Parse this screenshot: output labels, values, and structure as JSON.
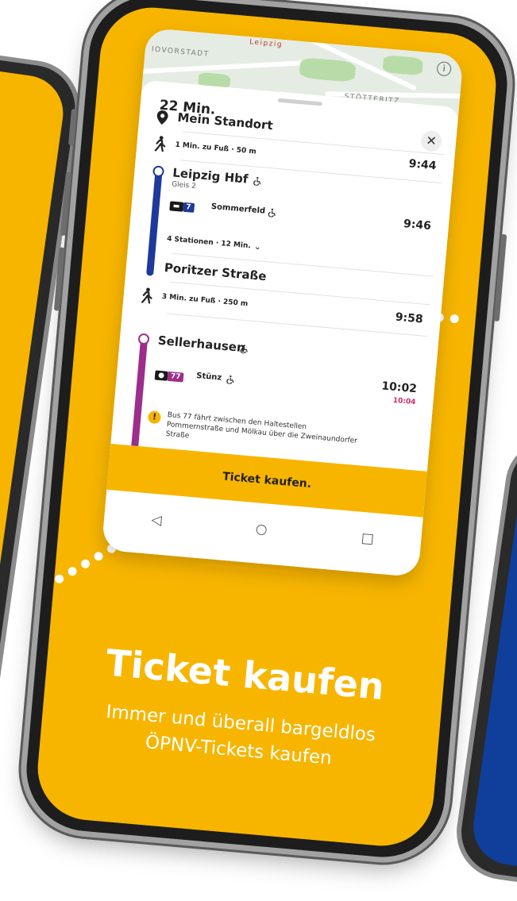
{
  "map": {
    "label_left": "IOVORSTADT",
    "label_top": "Leipzig",
    "label_right": "STÖTTERITZ",
    "info_glyph": "i"
  },
  "trip": {
    "duration": "22 Min.",
    "close_glyph": "✕",
    "start": {
      "name": "Mein Standort"
    },
    "walk1": {
      "text": "1 Min. zu Fuß · 50 m",
      "time": "9:44"
    },
    "stop1": {
      "name": "Leipzig Hbf",
      "platform": "Gleis 2",
      "line_badge": "7",
      "direction": "Sommerfeld",
      "time": "9:46",
      "stations": "4 Stationen · 12 Min."
    },
    "stop2": {
      "name": "Poritzer Straße"
    },
    "walk2": {
      "text": "3 Min. zu Fuß · 250 m",
      "time": "9:58"
    },
    "stop3": {
      "name": "Sellerhausen",
      "line_badge": "77",
      "direction": "Stünz",
      "time": "10:02",
      "time_delay": "10:04"
    },
    "notice": "Bus 77 fährt zwischen den Haltestellen Pommernstraße und Mölkau über die Zweinaundorfer Straße",
    "ticket_button": "Ticket kaufen."
  },
  "nav": {
    "back": "◁",
    "home": "○",
    "recents": "□"
  },
  "promo": {
    "title": "Ticket kaufen",
    "line1": "Immer und überall bargeldlos",
    "line2": "ÖPNV-Tickets kaufen"
  },
  "colors": {
    "brand_yellow": "#f7b500",
    "line_blue": "#1d3a9a",
    "line_purple": "#9c2f8c"
  },
  "icons": {
    "location": "location-pin-icon",
    "walk": "walking-icon",
    "accessible": "wheelchair-icon",
    "bus": "bus-icon",
    "tram": "tram-icon",
    "warning": "warning-icon"
  }
}
